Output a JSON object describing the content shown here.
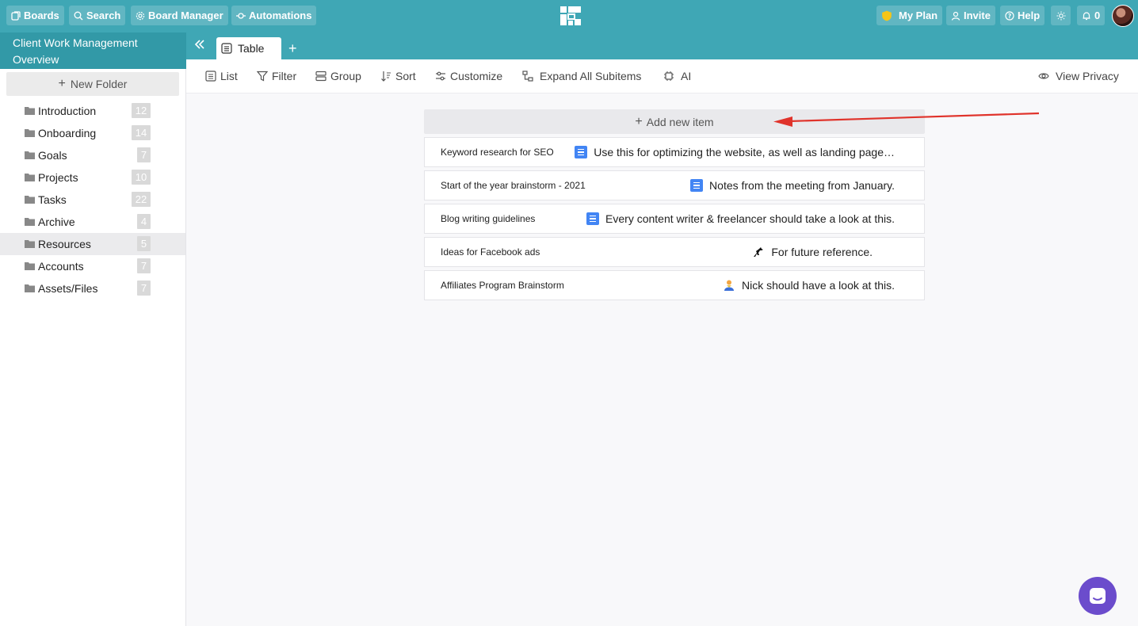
{
  "topbar": {
    "boards": "Boards",
    "search": "Search",
    "board_manager": "Board Manager",
    "automations": "Automations",
    "my_plan": "My Plan",
    "invite": "Invite",
    "help": "Help",
    "notifications": "0"
  },
  "board_title": "Client Work Management Overview",
  "tabs": {
    "table": "Table"
  },
  "sidebar": {
    "new_folder": "New Folder",
    "folders": [
      {
        "label": "Introduction",
        "count": "12"
      },
      {
        "label": "Onboarding",
        "count": "14"
      },
      {
        "label": "Goals",
        "count": "7"
      },
      {
        "label": "Projects",
        "count": "10"
      },
      {
        "label": "Tasks",
        "count": "22"
      },
      {
        "label": "Archive",
        "count": "4"
      },
      {
        "label": "Resources",
        "count": "5"
      },
      {
        "label": "Accounts",
        "count": "7"
      },
      {
        "label": "Assets/Files",
        "count": "7"
      }
    ],
    "active_folder": "Resources"
  },
  "toolbar": {
    "list": "List",
    "filter": "Filter",
    "group": "Group",
    "sort": "Sort",
    "customize": "Customize",
    "expand": "Expand All Subitems",
    "ai": "AI",
    "view_privacy": "View Privacy"
  },
  "main": {
    "add_item": "Add new item",
    "rows": [
      {
        "name": "Keyword research for SEO",
        "icon": "doc-icon",
        "note": "Use this for optimizing the website, as well as landing page…"
      },
      {
        "name": "Start of the year brainstorm - 2021",
        "icon": "doc-icon",
        "note": "Notes from the meeting from January."
      },
      {
        "name": "Blog writing guidelines",
        "icon": "doc-icon",
        "note": "Every content writer & freelancer should take a look at this."
      },
      {
        "name": "Ideas for Facebook ads",
        "icon": "horse-icon",
        "note": "For future reference."
      },
      {
        "name": "Affiliates Program Brainstorm",
        "icon": "person-icon",
        "note": "Nick should have a look at this."
      }
    ]
  },
  "colors": {
    "topbar": "#3fa7b5",
    "accent_arrow": "#e0332b",
    "chat_button": "#6b4ccc",
    "doc_icon": "#4285f4"
  }
}
